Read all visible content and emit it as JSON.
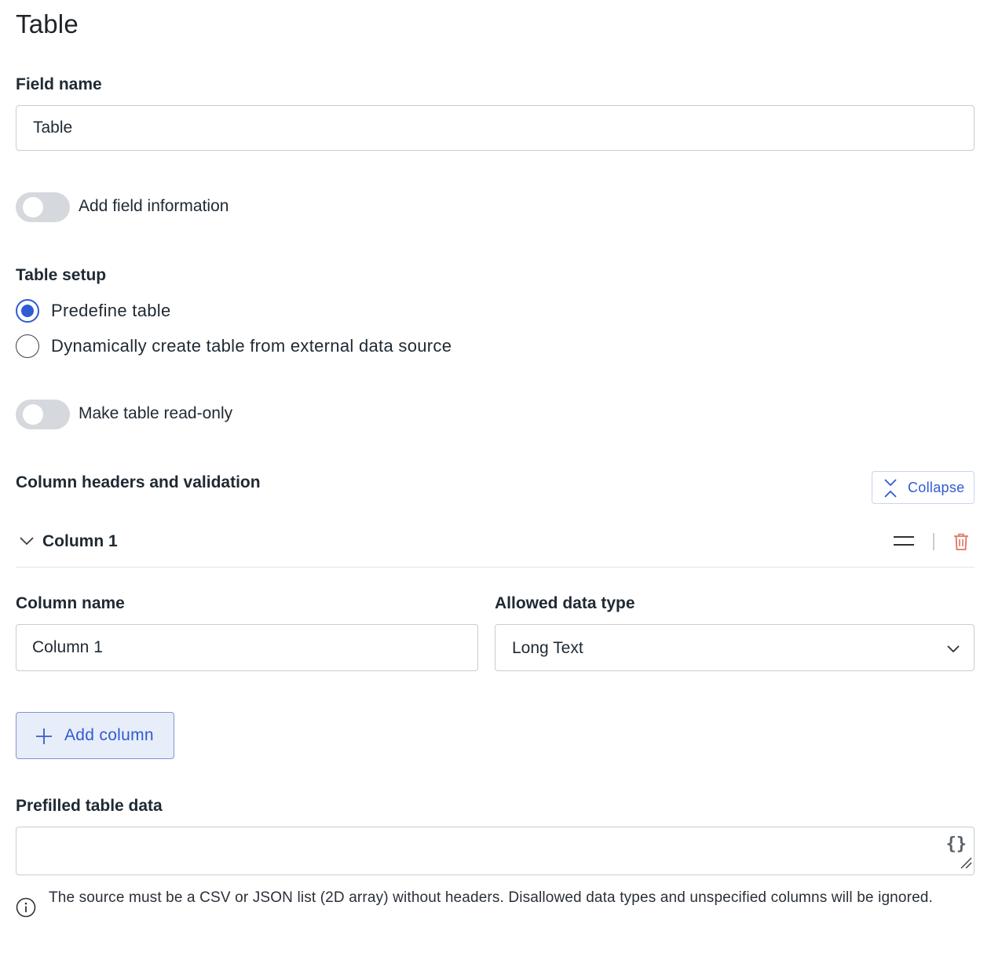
{
  "page": {
    "title": "Table"
  },
  "field_name": {
    "label": "Field name",
    "value": "Table"
  },
  "field_info_toggle": {
    "label": "Add field information",
    "on": false
  },
  "table_setup": {
    "label": "Table setup",
    "options": [
      {
        "label": "Predefine table",
        "checked": true
      },
      {
        "label": "Dynamically create table from external data source",
        "checked": false
      }
    ]
  },
  "read_only_toggle": {
    "label": "Make table read-only",
    "on": false
  },
  "columns_section": {
    "label": "Column headers and validation",
    "collapse_label": "Collapse",
    "columns": [
      {
        "title": "Column 1",
        "name_label": "Column name",
        "name_value": "Column 1",
        "type_label": "Allowed data type",
        "type_value": "Long Text"
      }
    ],
    "add_column_label": "Add column"
  },
  "prefilled": {
    "label": "Prefilled table data",
    "value": "",
    "braces": "{}",
    "help": "The source must be a CSV or JSON list (2D array) without headers. Disallowed data types and unspecified columns will be ignored."
  },
  "colors": {
    "accent": "#2f5bd3",
    "danger": "#e0735f",
    "toggle_off": "#d5d8dc"
  }
}
